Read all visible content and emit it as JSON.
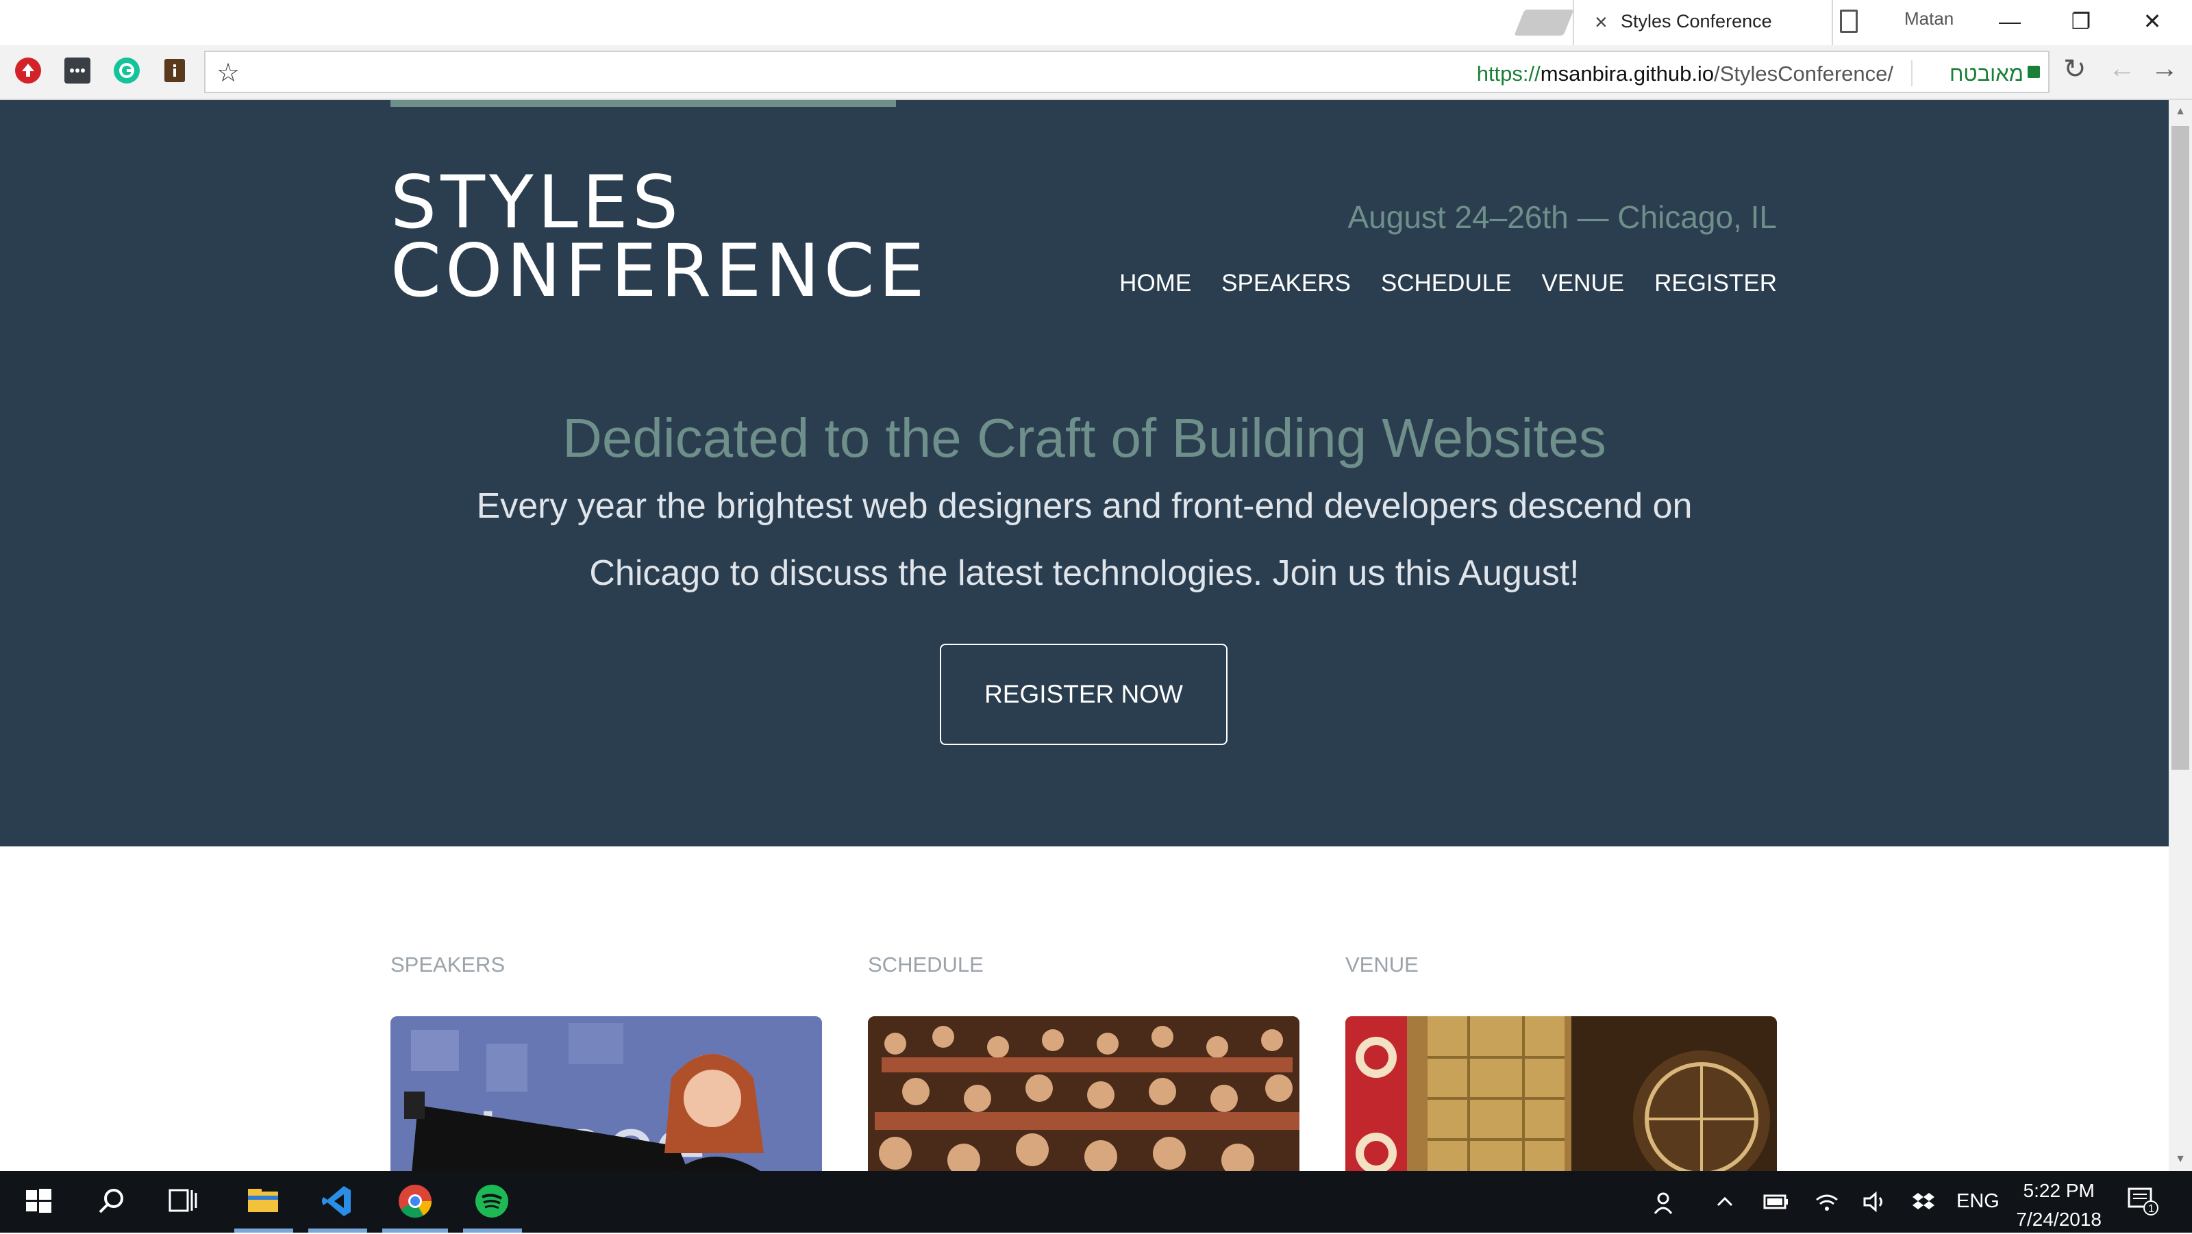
{
  "browser": {
    "tab_title": "Styles Conference",
    "profile_name": "Matan",
    "url_protocol": "https://",
    "url_host": "msanbira.github.io",
    "url_path": "/StylesConference/",
    "secure_label": "מאובטח",
    "tab_close_glyph": "×",
    "window_minimize": "—",
    "window_restore": "❐",
    "window_close": "✕",
    "star_glyph": "☆",
    "reload_glyph": "↻",
    "back_glyph": "←",
    "forward_glyph": "→"
  },
  "site": {
    "logo_line1": "STYLES",
    "logo_line2": "CONFERENCE",
    "date": "August 24–26th — Chicago, IL",
    "nav": [
      "HOME",
      "SPEAKERS",
      "SCHEDULE",
      "VENUE",
      "REGISTER"
    ],
    "hero_title": "Dedicated to the Craft of Building Websites",
    "hero_text": "Every year the brightest web designers and front-end developers descend on Chicago to discuss the latest technologies. Join us this August!",
    "cta": "REGISTER NOW",
    "features": [
      "SPEAKERS",
      "SCHEDULE",
      "VENUE"
    ],
    "image_text": "dance"
  },
  "taskbar": {
    "language": "ENG",
    "time": "5:22 PM",
    "date": "7/24/2018",
    "notification_count": "1"
  },
  "colors": {
    "hero_bg": "#2b3e50",
    "accent": "#6e8f8a",
    "taskbar_bg": "#101418"
  }
}
